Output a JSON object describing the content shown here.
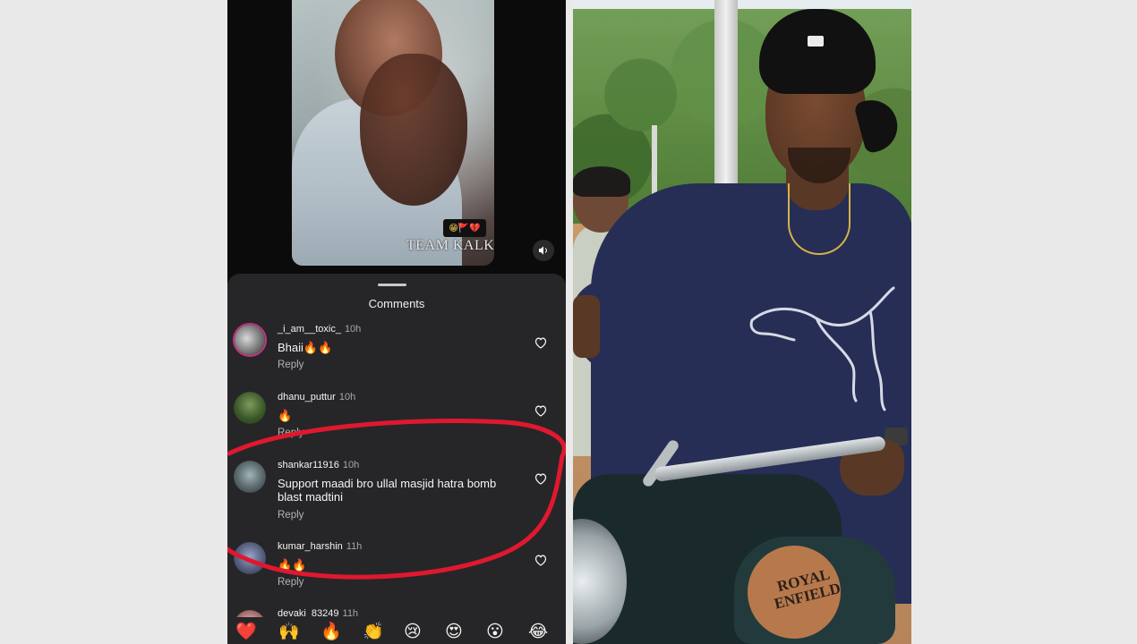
{
  "left_panel": {
    "video": {
      "watermark": "TEAM KALK",
      "badge_emoji": "😁🚩💔"
    },
    "comments_sheet": {
      "title": "Comments",
      "comments": [
        {
          "username": "_i_am__toxic_",
          "time": "10h",
          "text": "Bhaii🔥🔥",
          "reply_label": "Reply"
        },
        {
          "username": "dhanu_puttur",
          "time": "10h",
          "text": "🔥",
          "reply_label": "Reply"
        },
        {
          "username": "shankar11916",
          "time": "10h",
          "text": "Support maadi bro ullal masjid hatra bomb blast madtini",
          "reply_label": "Reply"
        },
        {
          "username": "kumar_harshin",
          "time": "11h",
          "text": "🔥🔥",
          "reply_label": "Reply"
        },
        {
          "username": "devaki_83249",
          "time": "11h"
        }
      ],
      "emoji_bar": [
        "❤️",
        "🙌",
        "🔥",
        "👏",
        "😢",
        "😍",
        "😮",
        "😂"
      ],
      "highlight_color": "#e0182f"
    }
  },
  "right_panel": {
    "tank_brand": "ROYAL ENFIELD",
    "tank_brand_lines": [
      "ROYAL",
      "ENFIELD"
    ]
  }
}
